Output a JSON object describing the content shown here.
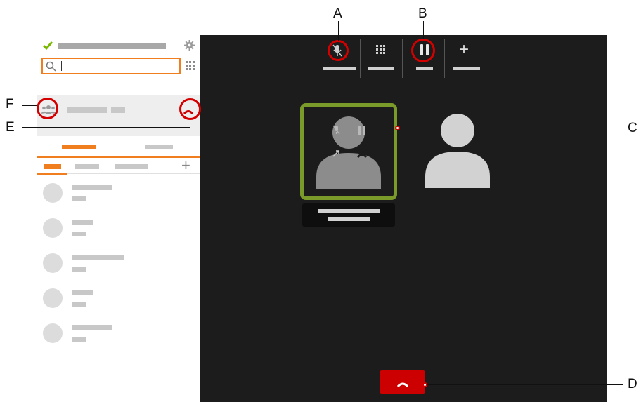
{
  "callouts": {
    "a": "A",
    "b": "B",
    "c": "C",
    "d": "D",
    "e": "E",
    "f": "F"
  },
  "icons": {
    "status": "checkmark-icon",
    "settings": "gear-icon",
    "search": "search-icon",
    "dialpad": "dialpad-icon",
    "conference": "group-icon",
    "hangup": "hangup-icon",
    "mute": "microphone-muted-icon",
    "hold": "pause-icon",
    "add": "plus-icon",
    "avatar": "person-icon"
  },
  "colors": {
    "accent": "#f07d1e",
    "status_ok": "#7ab800",
    "hangup": "#cc0000",
    "highlight": "#d40000",
    "active_participant_border": "#7a9a2a",
    "stage_background": "#1c1c1c"
  },
  "toolbar": {
    "add_glyph": "+"
  },
  "sidebar": {
    "add_tab_glyph": "+",
    "contacts_count": 5
  }
}
